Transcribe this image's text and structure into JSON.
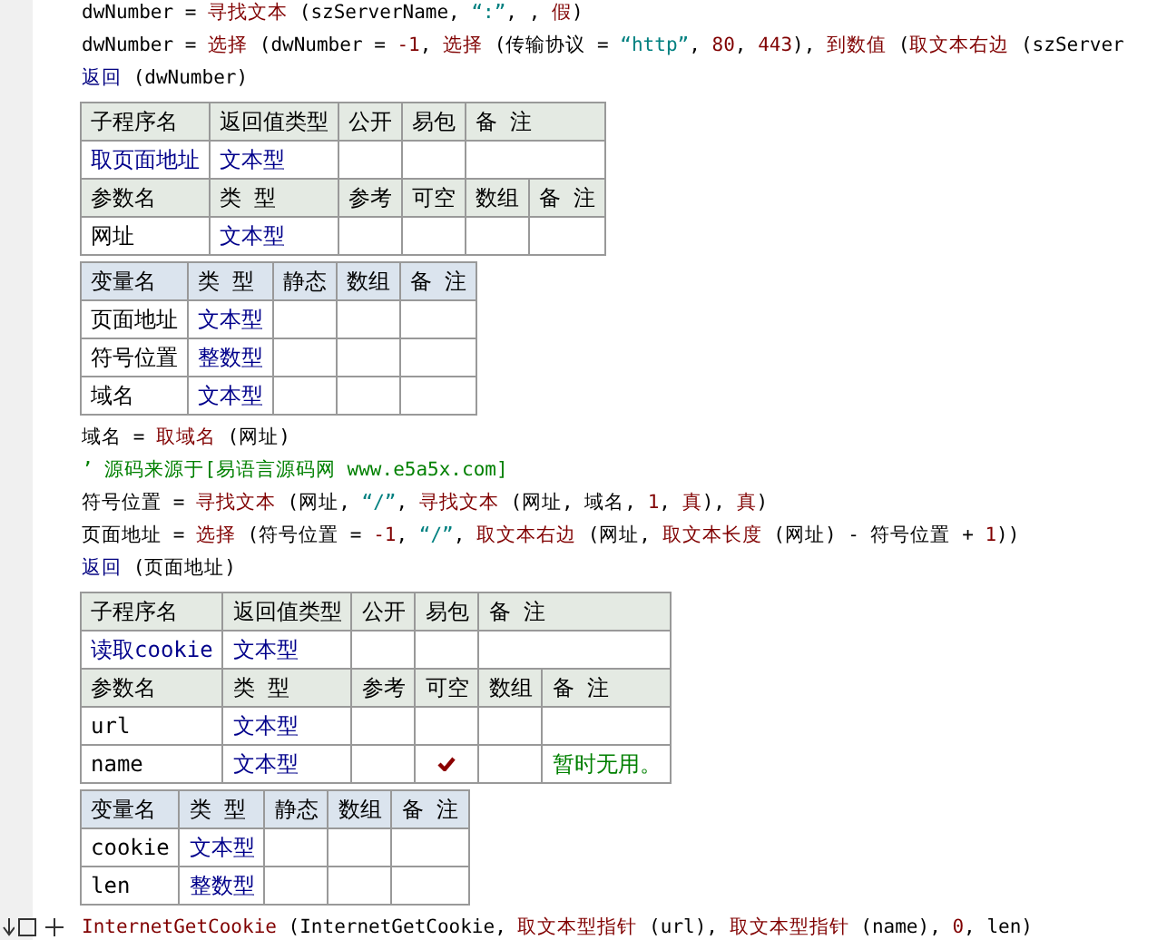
{
  "blocks": [
    {
      "kind": "code",
      "segments": [
        {
          "kind": "plain",
          "text": "dwNumber = "
        },
        {
          "kind": "func",
          "text": "寻找文本"
        },
        {
          "kind": "plain",
          "text": " (szServerName, "
        },
        {
          "kind": "str",
          "text": "“:”"
        },
        {
          "kind": "plain",
          "text": ", , "
        },
        {
          "kind": "func",
          "text": "假"
        },
        {
          "kind": "plain",
          "text": ")"
        }
      ]
    },
    {
      "kind": "code",
      "segments": [
        {
          "kind": "plain",
          "text": "dwNumber = "
        },
        {
          "kind": "func",
          "text": "选择"
        },
        {
          "kind": "plain",
          "text": " (dwNumber = "
        },
        {
          "kind": "num",
          "text": "-1"
        },
        {
          "kind": "plain",
          "text": ", "
        },
        {
          "kind": "func",
          "text": "选择"
        },
        {
          "kind": "plain",
          "text": " (传输协议 = "
        },
        {
          "kind": "str",
          "text": "“http”"
        },
        {
          "kind": "plain",
          "text": ", "
        },
        {
          "kind": "num",
          "text": "80"
        },
        {
          "kind": "plain",
          "text": ", "
        },
        {
          "kind": "num",
          "text": "443"
        },
        {
          "kind": "plain",
          "text": "), "
        },
        {
          "kind": "func",
          "text": "到数值"
        },
        {
          "kind": "plain",
          "text": " ("
        },
        {
          "kind": "func",
          "text": "取文本右边"
        },
        {
          "kind": "plain",
          "text": " (szServer"
        }
      ]
    },
    {
      "kind": "code",
      "segments": [
        {
          "kind": "kw",
          "text": "返回"
        },
        {
          "kind": "plain",
          "text": " (dwNumber)"
        }
      ]
    },
    {
      "kind": "sub",
      "headers": [
        "子程序名",
        "返回值类型",
        "公开",
        "易包",
        "备 注"
      ],
      "name": "取页面地址",
      "return_type": "文本型",
      "param_headers": [
        "参数名",
        "类 型",
        "参考",
        "可空",
        "数组",
        "备 注"
      ],
      "params": [
        {
          "name": "网址",
          "type": "文本型",
          "nullable": false
        }
      ]
    },
    {
      "kind": "vars",
      "headers": [
        "变量名",
        "类 型",
        "静态",
        "数组",
        "备 注"
      ],
      "vars": [
        {
          "name": "页面地址",
          "type": "文本型"
        },
        {
          "name": "符号位置",
          "type": "整数型"
        },
        {
          "name": "域名",
          "type": "文本型"
        }
      ]
    },
    {
      "kind": "code",
      "segments": [
        {
          "kind": "plain",
          "text": "域名 = "
        },
        {
          "kind": "func",
          "text": "取域名"
        },
        {
          "kind": "plain",
          "text": " (网址)"
        }
      ]
    },
    {
      "kind": "code",
      "segments": [
        {
          "kind": "comment",
          "text": "’ 源码来源于[易语言源码网 www.e5a5x.com]"
        }
      ]
    },
    {
      "kind": "code",
      "segments": [
        {
          "kind": "plain",
          "text": "符号位置 = "
        },
        {
          "kind": "func",
          "text": "寻找文本"
        },
        {
          "kind": "plain",
          "text": " (网址, "
        },
        {
          "kind": "str",
          "text": "“/”"
        },
        {
          "kind": "plain",
          "text": ", "
        },
        {
          "kind": "func",
          "text": "寻找文本"
        },
        {
          "kind": "plain",
          "text": " (网址, 域名, "
        },
        {
          "kind": "num",
          "text": "1"
        },
        {
          "kind": "plain",
          "text": ", "
        },
        {
          "kind": "func",
          "text": "真"
        },
        {
          "kind": "plain",
          "text": "), "
        },
        {
          "kind": "func",
          "text": "真"
        },
        {
          "kind": "plain",
          "text": ")"
        }
      ]
    },
    {
      "kind": "code",
      "segments": [
        {
          "kind": "plain",
          "text": "页面地址 = "
        },
        {
          "kind": "func",
          "text": "选择"
        },
        {
          "kind": "plain",
          "text": " (符号位置 = "
        },
        {
          "kind": "num",
          "text": "-1"
        },
        {
          "kind": "plain",
          "text": ", "
        },
        {
          "kind": "str",
          "text": "“/”"
        },
        {
          "kind": "plain",
          "text": ", "
        },
        {
          "kind": "func",
          "text": "取文本右边"
        },
        {
          "kind": "plain",
          "text": " (网址, "
        },
        {
          "kind": "func",
          "text": "取文本长度"
        },
        {
          "kind": "plain",
          "text": " (网址) - 符号位置 + "
        },
        {
          "kind": "num",
          "text": "1"
        },
        {
          "kind": "plain",
          "text": "))"
        }
      ]
    },
    {
      "kind": "code",
      "segments": [
        {
          "kind": "kw",
          "text": "返回"
        },
        {
          "kind": "plain",
          "text": " (页面地址)"
        }
      ]
    },
    {
      "kind": "sub",
      "headers": [
        "子程序名",
        "返回值类型",
        "公开",
        "易包",
        "备 注"
      ],
      "name": "读取cookie",
      "return_type": "文本型",
      "param_headers": [
        "参数名",
        "类 型",
        "参考",
        "可空",
        "数组",
        "备 注"
      ],
      "params": [
        {
          "name": "url",
          "type": "文本型",
          "nullable": false
        },
        {
          "name": "name",
          "type": "文本型",
          "nullable": true,
          "note": "暂时无用。"
        }
      ]
    },
    {
      "kind": "vars",
      "headers": [
        "变量名",
        "类 型",
        "静态",
        "数组",
        "备 注"
      ],
      "vars": [
        {
          "name": "cookie",
          "type": "文本型"
        },
        {
          "name": "len",
          "type": "整数型"
        }
      ]
    },
    {
      "kind": "code",
      "fold_marker": true,
      "segments": [
        {
          "kind": "func",
          "text": "InternetGetCookie"
        },
        {
          "kind": "plain",
          "text": " (InternetGetCookie, "
        },
        {
          "kind": "func",
          "text": "取文本型指针"
        },
        {
          "kind": "plain",
          "text": " (url), "
        },
        {
          "kind": "func",
          "text": "取文本型指针"
        },
        {
          "kind": "plain",
          "text": " (name), "
        },
        {
          "kind": "num",
          "text": "0"
        },
        {
          "kind": "plain",
          "text": ", len)"
        }
      ]
    }
  ]
}
